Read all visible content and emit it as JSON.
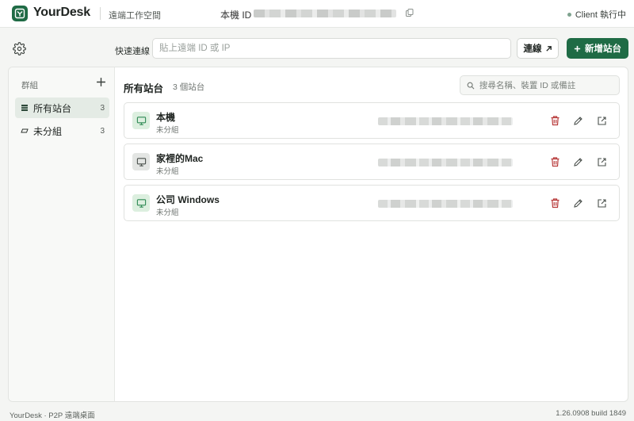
{
  "app": {
    "brand": "YourDesk",
    "tagline": "遠端工作空間",
    "local_id_label": "本機 ID",
    "status_text": "Client 執行中",
    "colors": {
      "accent": "#1f6b45",
      "danger": "#b83b3b"
    }
  },
  "quick_connect": {
    "label": "快速連線",
    "placeholder": "貼上遠端 ID 或 IP",
    "connect_label": "連線",
    "add_label": "新增站台"
  },
  "sidebar": {
    "title": "群組",
    "groups": [
      {
        "label": "所有站台",
        "count": "3",
        "icon": "list-icon",
        "active": true
      },
      {
        "label": "未分組",
        "count": "3",
        "icon": "tag-icon",
        "active": false
      }
    ]
  },
  "content": {
    "title": "所有站台",
    "count_text": "3 個站台",
    "search_placeholder": "搜尋名稱、裝置 ID 或備註",
    "devices": [
      {
        "name": "本機",
        "group": "未分組",
        "icon": "monitor-icon",
        "icon_style": "green"
      },
      {
        "name": "家裡的Mac",
        "group": "未分組",
        "icon": "monitor-icon",
        "icon_style": "gray"
      },
      {
        "name": "公司 Windows",
        "group": "未分組",
        "icon": "monitor-icon",
        "icon_style": "green"
      }
    ]
  },
  "footer": {
    "left": "YourDesk · P2P 遠端桌面",
    "right": "1.26.0908 build 1849"
  }
}
